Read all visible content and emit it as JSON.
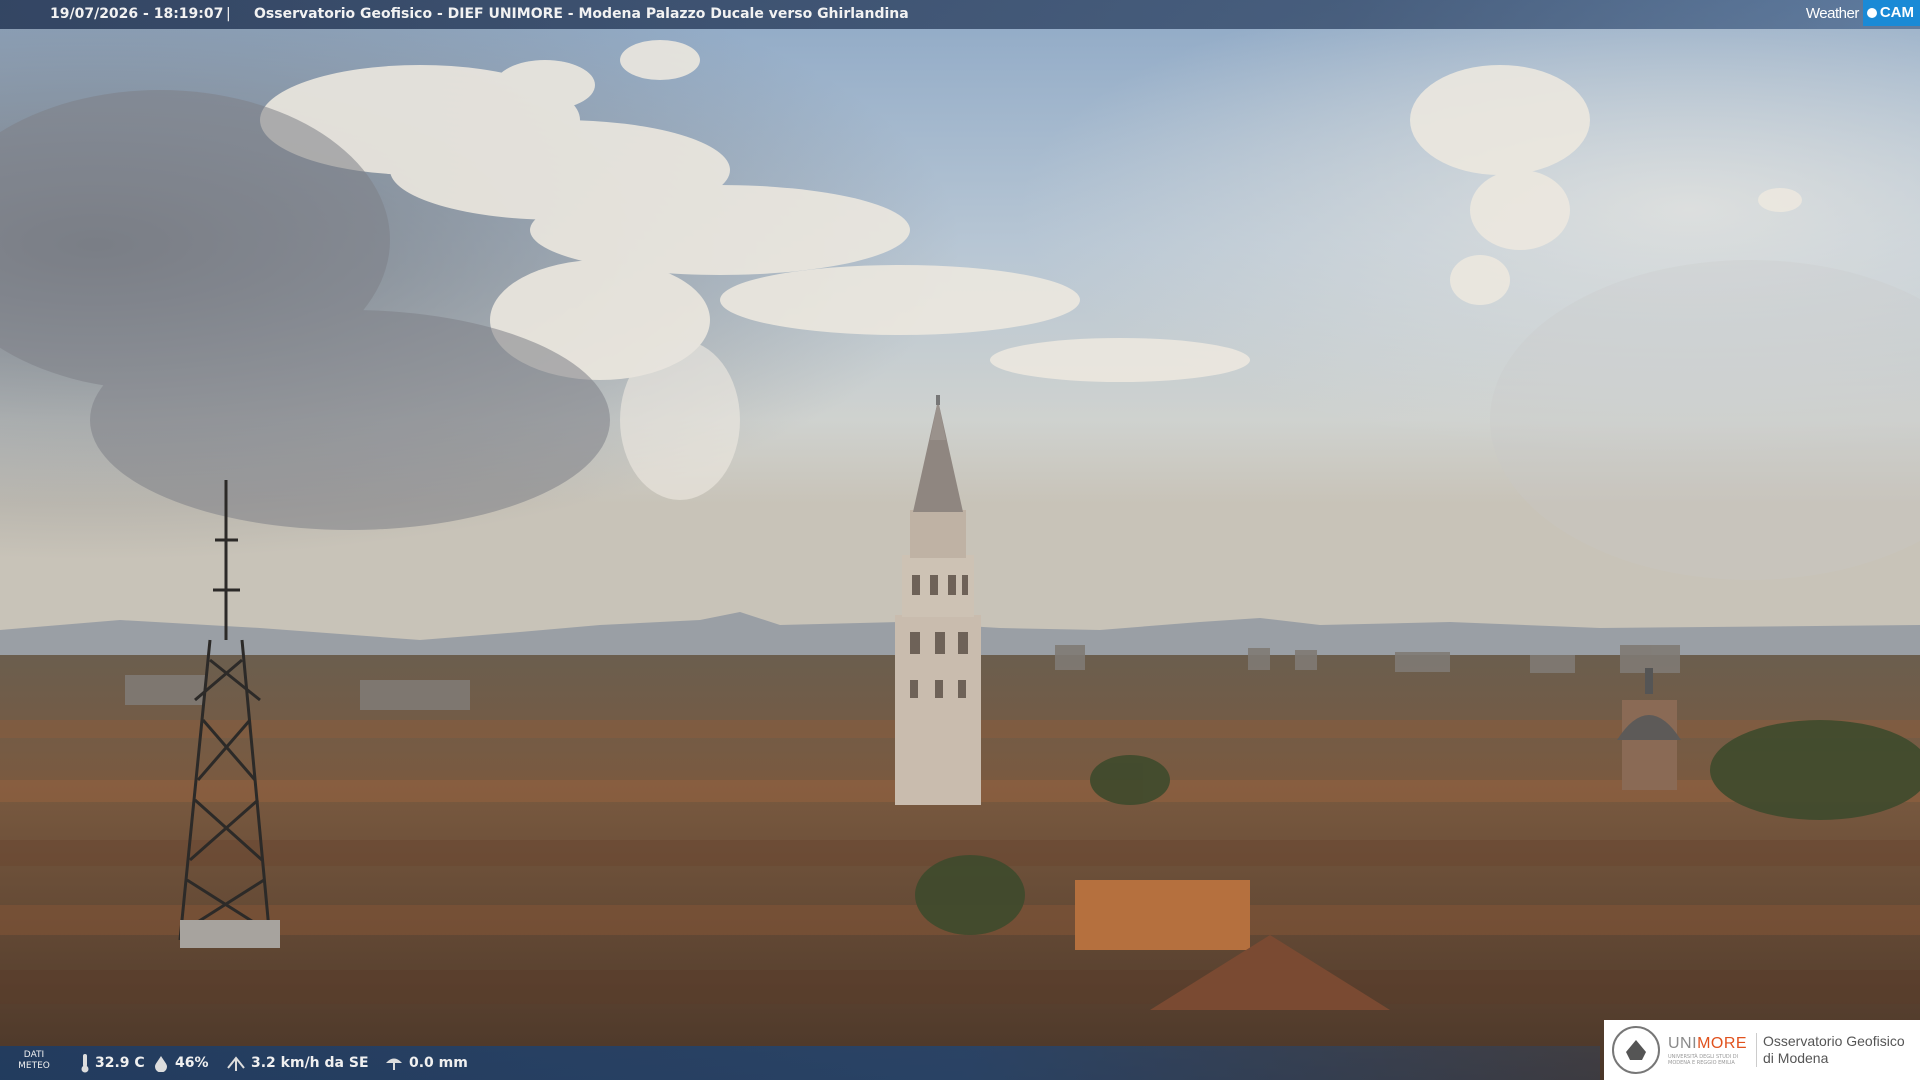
{
  "caption": {
    "timestamp": "19/07/2026 - 18:19:07",
    "separator": "|",
    "title": "Osservatorio Geofisico - DIEF UNIMORE - Modena Palazzo Ducale verso Ghirlandina"
  },
  "brand": {
    "weather": "Weather",
    "cam": "CAM"
  },
  "weather_bar": {
    "label_line1": "DATI",
    "label_line2": "METEO",
    "temperature": "32.9 C",
    "humidity": "46%",
    "wind": "3.2 km/h da SE",
    "rain": "0.0 mm",
    "icons": [
      "thermometer-icon",
      "humidity-drop-icon",
      "wind-icon",
      "rain-icon"
    ]
  },
  "logo": {
    "uni_prefix": "UNI",
    "uni_suffix": "MORE",
    "uni_sub": "UNIVERSITÀ DEGLI STUDI DI MODENA E REGGIO EMILIA",
    "obs_line1": "Osservatorio Geofisico",
    "obs_line2": "di Modena"
  },
  "colors": {
    "accent_orange": "#e0521e",
    "cam_blue": "#1a8ad6",
    "bar_blue": "#2c3e5c"
  }
}
